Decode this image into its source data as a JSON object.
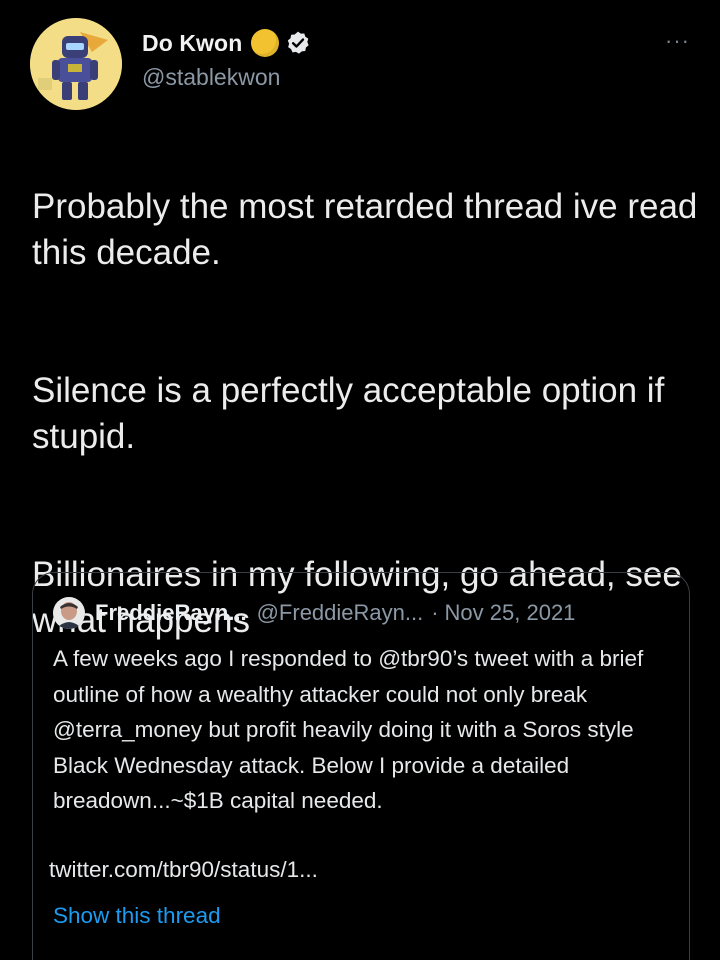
{
  "author": {
    "display_name": "Do Kwon",
    "handle": "@stablekwon",
    "avatar_icon": "robot-avatar-icon",
    "emoji_icon": "yellow-circle-emoji",
    "verified_icon": "verified-badge-icon"
  },
  "menu": {
    "more_label": "···"
  },
  "tweet": {
    "paragraphs": [
      "Probably the most retarded thread ive read this decade.",
      "Silence is a perfectly acceptable option if stupid.",
      "Billionaires in my following, go ahead, see what happens"
    ]
  },
  "quoted": {
    "avatar_icon": "user-photo-avatar",
    "name": "FreddieRayn...",
    "handle": "@FreddieRayn...",
    "separator": "·",
    "date": "Nov 25, 2021",
    "text": "A few weeks ago I responded to @tbr90’s tweet with a brief outline of how a wealthy attacker could not only break @terra_money but profit heavily doing it with a Soros style Black Wednesday attack. Below I provide a detailed breadown...~$1B capital needed.",
    "link": "twitter.com/tbr90/status/1...",
    "show_thread": "Show this thread"
  },
  "colors": {
    "background": "#000000",
    "text": "#e7e9ea",
    "secondary": "#8b98a5",
    "accent_link": "#1d9bf0",
    "verified": "#e7e9ea"
  }
}
